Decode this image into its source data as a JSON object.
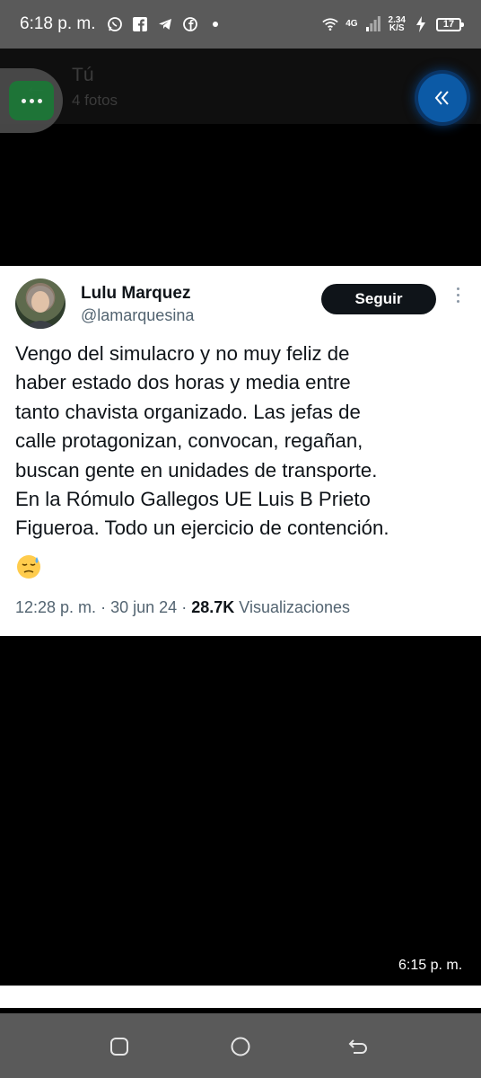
{
  "status_bar": {
    "time": "6:18 p. m.",
    "network": "4G",
    "speed_value": "2.34",
    "speed_unit": "K/S",
    "battery": "17",
    "icons": [
      "whatsapp-icon",
      "facebook-icon",
      "telegram-icon",
      "facebook-messenger-icon",
      "notification-dot",
      "wifi-icon",
      "signal-icon",
      "charging-icon",
      "battery-icon"
    ]
  },
  "viewer": {
    "title": "Tú",
    "subtitle": "4 fotos"
  },
  "tweet": {
    "author_name": "Lulu Marquez",
    "author_handle": "@lamarquesina",
    "follow_label": "Seguir",
    "text_lines": [
      "Vengo del simulacro y no muy feliz de",
      "haber estado dos horas y media entre",
      "tanto  chavista organizado. Las jefas de",
      "calle protagonizan, convocan, regañan,",
      "buscan gente en unidades de transporte.",
      "En la Rómulo Gallegos UE Luis  B Prieto",
      "Figueroa. Todo un ejercicio de contención."
    ],
    "emoji": "sad-face-emoji",
    "time": "12:28 p. m.",
    "separator": "·",
    "date": "30 jun 24",
    "views_count": "28.7K",
    "views_label": "Visualizaciones"
  },
  "photo_timestamp": "6:15 p. m.",
  "colors": {
    "status_bar": "#5a5a5a",
    "accent_blue": "#0c5aa6",
    "menu_green": "#1f7a3a",
    "text_primary": "#0f1419",
    "text_secondary": "#536471"
  }
}
